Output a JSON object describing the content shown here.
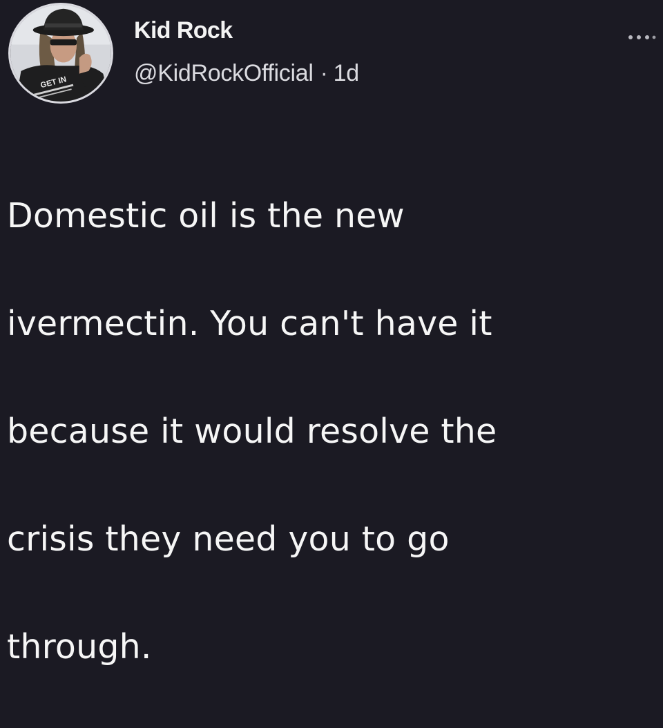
{
  "author": {
    "display_name": "Kid Rock",
    "handle": "@KidRockOfficial",
    "time_ago": "1d",
    "separator": "·",
    "avatar_shirt_text": "GET IN"
  },
  "tweet": {
    "lines": [
      "Domestic oil is the new",
      "ivermectin. You can't have it",
      "because it would resolve the",
      "crisis they need you to go",
      "through."
    ]
  },
  "icons": {
    "more": "more-horizontal-icon"
  },
  "colors": {
    "background": "#1b1a23",
    "text": "#f6f6f6",
    "muted": "#dbdbe0"
  }
}
